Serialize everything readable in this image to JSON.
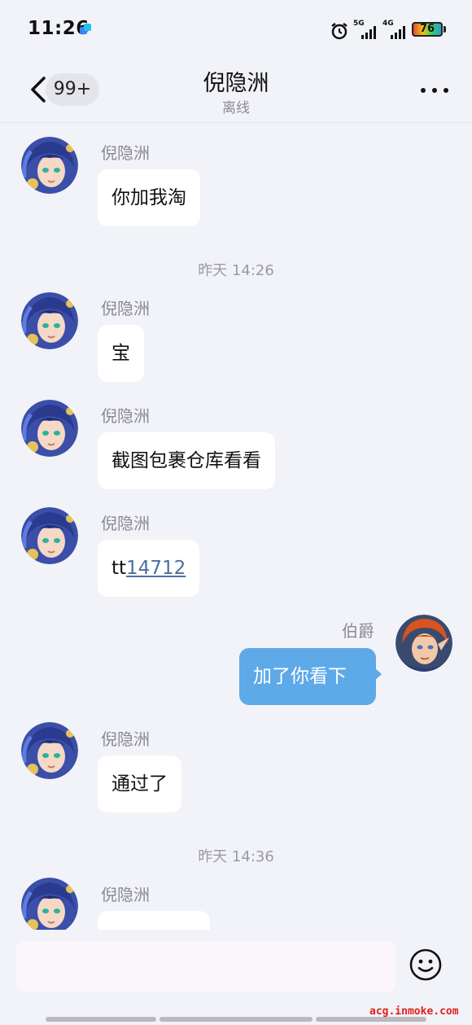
{
  "status_bar": {
    "time": "11:26",
    "net_5g": "5G",
    "net_4g": "4G",
    "battery": "76"
  },
  "header": {
    "unread_count": "99+",
    "title": "倪隐洲",
    "status": "离线"
  },
  "messages": [
    {
      "sender": "倪隐洲",
      "text": "你加我淘"
    },
    {
      "sender": "倪隐洲",
      "text": "宝"
    },
    {
      "sender": "倪隐洲",
      "text": "截图包裹仓库看看"
    },
    {
      "sender": "倪隐洲",
      "text_prefix": "tt",
      "link": "14712"
    },
    {
      "sender": "伯爵",
      "text": "加了你看下"
    },
    {
      "sender": "倪隐洲",
      "text": "通过了"
    },
    {
      "sender": "倪隐洲",
      "text": ""
    }
  ],
  "timestamps": [
    "昨天 14:26",
    "昨天 14:36"
  ],
  "input": {
    "placeholder": ""
  },
  "watermark": "acg.inmoke.com",
  "colors": {
    "accent": "#5ea9e8",
    "background": "#f2f3f8",
    "link": "#4a6f9c"
  }
}
